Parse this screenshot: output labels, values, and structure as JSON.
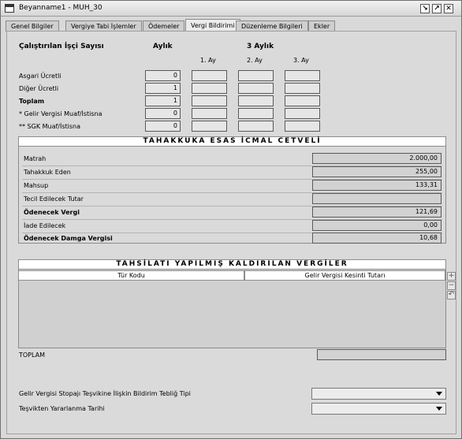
{
  "window": {
    "title": "Beyanname1 - MUH_30"
  },
  "tabs": [
    "Genel Bilgiler",
    "Vergiye Tabi İşlemler",
    "Ödemeler",
    "Vergi Bildirimi",
    "Düzenleme Bilgileri",
    "Ekler"
  ],
  "workers": {
    "title": "Çalıştırılan İşçi Sayısı",
    "col_monthly": "Aylık",
    "col_quarter": "3 Aylık",
    "months": [
      "1. Ay",
      "2. Ay",
      "3. Ay"
    ],
    "rows": [
      {
        "label": "Asgari Ücretli",
        "value": "0"
      },
      {
        "label": "Diğer Ücretli",
        "value": "1"
      },
      {
        "label": "Toplam",
        "value": "1"
      },
      {
        "label": "* Gelir Vergisi Muaf/İstisna",
        "value": "0"
      },
      {
        "label": "** SGK Muaf/İstisna",
        "value": "0"
      }
    ]
  },
  "icmal": {
    "title": "TAHAKKUKA ESAS İCMAL CETVELİ",
    "rows": [
      {
        "label": "Matrah",
        "value": "2.000,00"
      },
      {
        "label": "Tahakkuk Eden",
        "value": "255,00"
      },
      {
        "label": "Mahsup",
        "value": "133,31"
      },
      {
        "label": "Tecil Edilecek Tutar",
        "value": ""
      },
      {
        "label": "Ödenecek Vergi",
        "value": "121,69"
      },
      {
        "label": "İade Edilecek",
        "value": "0,00"
      },
      {
        "label": "Ödenecek Damga Vergisi",
        "value": "10,68"
      }
    ]
  },
  "tahsilat": {
    "title": "TAHSİLATI YAPILMIŞ KALDIRILAN VERGİLER",
    "col_type": "Tür Kodu",
    "col_amount": "Gelir Vergisi Kesinti Tutarı",
    "total_label": "TOPLAM",
    "total_value": ""
  },
  "bottom": {
    "tesvik_label": "Gelir Vergisi Stopajı Teşvikine İlişkin Bildirim Tebliğ Tipi",
    "tesvik_value": "",
    "date_label": "Teşvikten Yararlanma Tarihi",
    "date_value": ""
  }
}
